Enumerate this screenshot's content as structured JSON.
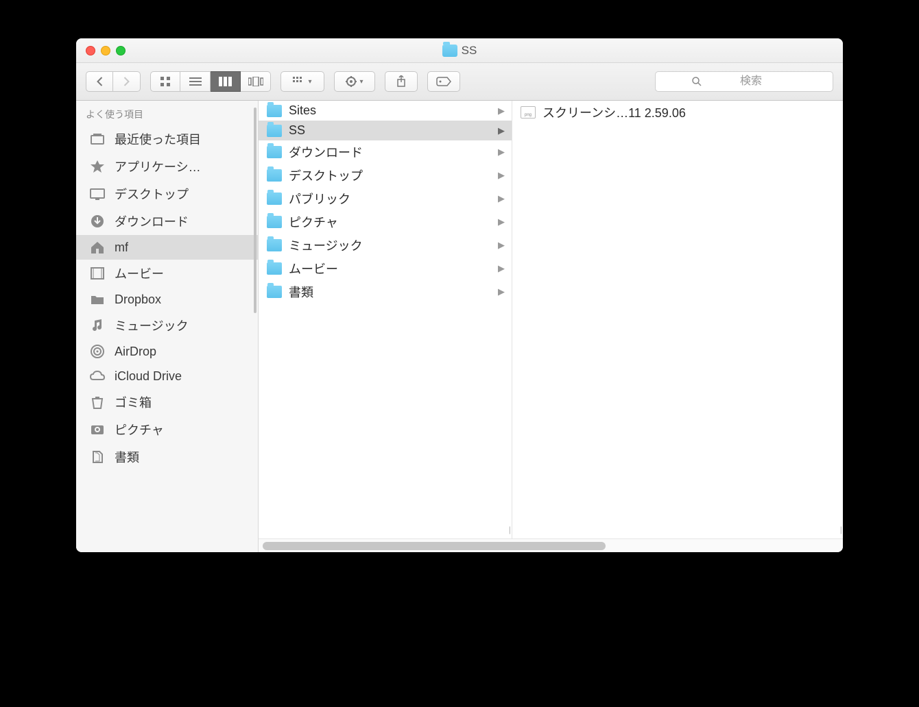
{
  "window": {
    "title": "SS"
  },
  "toolbar": {
    "search_placeholder": "検索"
  },
  "sidebar": {
    "section_title": "よく使う項目",
    "items": [
      {
        "label": "最近使った項目",
        "icon": "recents",
        "selected": false
      },
      {
        "label": "アプリケーシ…",
        "icon": "applications",
        "selected": false
      },
      {
        "label": "デスクトップ",
        "icon": "desktop",
        "selected": false
      },
      {
        "label": "ダウンロード",
        "icon": "downloads",
        "selected": false
      },
      {
        "label": "mf",
        "icon": "home",
        "selected": true
      },
      {
        "label": "ムービー",
        "icon": "movies",
        "selected": false
      },
      {
        "label": "Dropbox",
        "icon": "folder",
        "selected": false
      },
      {
        "label": "ミュージック",
        "icon": "music",
        "selected": false
      },
      {
        "label": "AirDrop",
        "icon": "airdrop",
        "selected": false
      },
      {
        "label": "iCloud Drive",
        "icon": "icloud",
        "selected": false
      },
      {
        "label": "ゴミ箱",
        "icon": "trash",
        "selected": false
      },
      {
        "label": "ピクチャ",
        "icon": "pictures",
        "selected": false
      },
      {
        "label": "書類",
        "icon": "documents",
        "selected": false
      }
    ]
  },
  "columns": [
    {
      "items": [
        {
          "label": "Sites",
          "type": "folder",
          "selected": false,
          "has_children": true
        },
        {
          "label": "SS",
          "type": "folder",
          "selected": true,
          "has_children": true
        },
        {
          "label": "ダウンロード",
          "type": "folder",
          "selected": false,
          "has_children": true
        },
        {
          "label": "デスクトップ",
          "type": "folder",
          "selected": false,
          "has_children": true
        },
        {
          "label": "パブリック",
          "type": "folder",
          "selected": false,
          "has_children": true
        },
        {
          "label": "ピクチャ",
          "type": "folder",
          "selected": false,
          "has_children": true
        },
        {
          "label": "ミュージック",
          "type": "folder",
          "selected": false,
          "has_children": true
        },
        {
          "label": "ムービー",
          "type": "folder",
          "selected": false,
          "has_children": true
        },
        {
          "label": "書類",
          "type": "folder",
          "selected": false,
          "has_children": true
        }
      ]
    },
    {
      "items": [
        {
          "label": "スクリーンシ…11 2.59.06",
          "type": "image",
          "selected": false,
          "has_children": false
        }
      ]
    }
  ]
}
